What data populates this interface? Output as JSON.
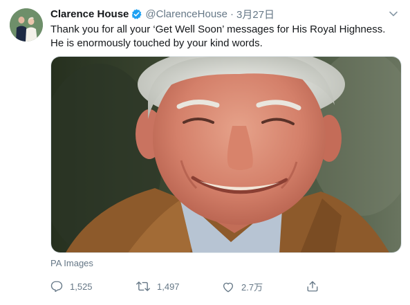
{
  "tweet": {
    "author_name": "Clarence House",
    "handle": "@ClarenceHouse",
    "separator": "·",
    "date": "3月27日",
    "verified": true,
    "text_line1": "Thank you for all your ‘Get Well Soon’ messages for His Royal Highness.",
    "text_line2": "He is enormously touched by your kind words.",
    "media_credit": "PA Images"
  },
  "actions": {
    "reply_count": "1,525",
    "retweet_count": "1,497",
    "like_count": "2.7万"
  },
  "icons": {
    "verified": "verified-badge-icon",
    "caret": "chevron-down-icon",
    "reply": "reply-icon",
    "retweet": "retweet-icon",
    "like": "heart-icon",
    "share": "share-icon"
  },
  "colors": {
    "text": "#14171a",
    "secondary": "#657786",
    "verified": "#1da1f2"
  }
}
